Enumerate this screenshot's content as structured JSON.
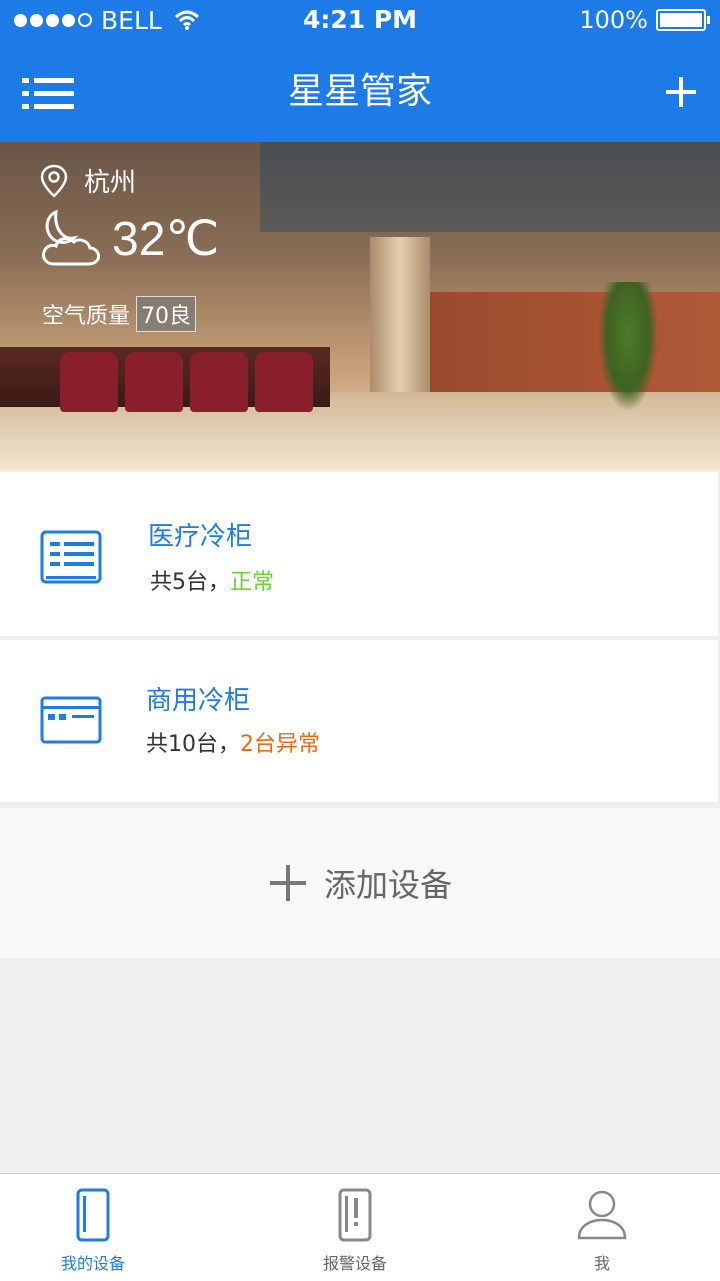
{
  "status_bar": {
    "carrier": "BELL",
    "time": "4:21 PM",
    "battery": "100%"
  },
  "header": {
    "title": "星星管家"
  },
  "weather": {
    "city": "杭州",
    "temperature": "32℃",
    "air_quality_label": "空气质量",
    "air_quality_value": "70良"
  },
  "devices": [
    {
      "name": "医疗冷柜",
      "count_text": "共5台，",
      "status_text": "正常",
      "icon": "medical-freezer-icon"
    },
    {
      "name": "商用冷柜",
      "count_text": "共10台，",
      "status_text": "2台异常",
      "icon": "commercial-freezer-icon"
    }
  ],
  "add_device": {
    "label": "添加设备"
  },
  "tabs": [
    {
      "label": "我的设备",
      "icon": "fridge-icon",
      "active": true
    },
    {
      "label": "报警设备",
      "icon": "alarm-fridge-icon",
      "active": false
    },
    {
      "label": "我",
      "icon": "user-icon",
      "active": false
    }
  ],
  "colors": {
    "primary": "#1c7be6",
    "ok": "#6ad23a",
    "warn": "#e86a14"
  }
}
